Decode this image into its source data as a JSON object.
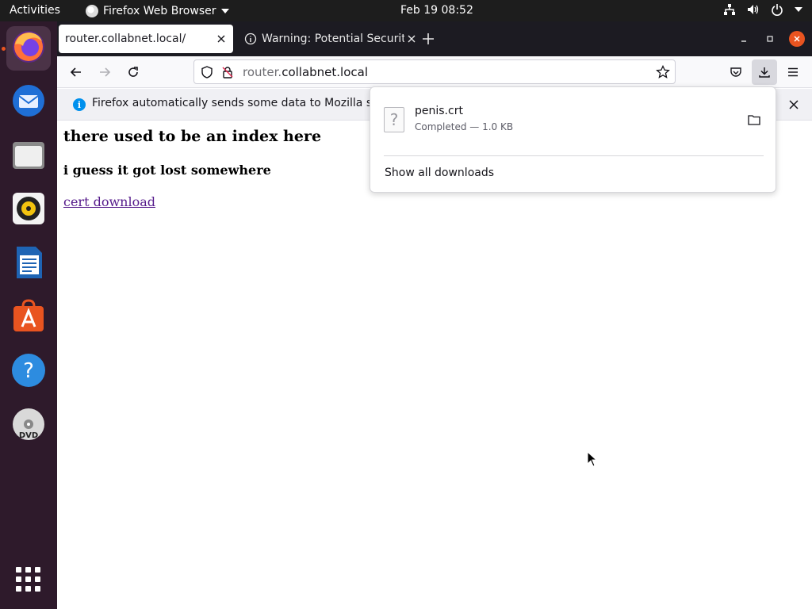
{
  "topbar": {
    "activities": "Activities",
    "app_name": "Firefox Web Browser",
    "clock": "Feb 19  08:52",
    "icons": [
      "network-icon",
      "volume-icon",
      "power-icon",
      "chevron-down-icon"
    ]
  },
  "dock": {
    "items": [
      "firefox",
      "thunderbird",
      "files",
      "rhythmbox",
      "libreoffice-writer",
      "ubuntu-software",
      "help",
      "dvd",
      "show-applications"
    ]
  },
  "browser": {
    "tabs": [
      {
        "title": "router.collabnet.local/",
        "active": true
      },
      {
        "title": "Warning: Potential Security Risk Ahead",
        "active": false
      }
    ],
    "url": {
      "dim": "router.",
      "host": "collabnet.local"
    },
    "notification": {
      "text": "Firefox automatically sends some data to Mozilla so that we can improve your experience."
    },
    "page": {
      "heading": "there used to be an index here",
      "subheading": "i guess it got lost somewhere",
      "link": "cert download"
    },
    "downloads_panel": {
      "file_name": "penis.crt",
      "status": "Completed — 1.0 KB",
      "show_all": "Show all downloads"
    }
  },
  "colors": {
    "accent": "#e95420",
    "dock_bg": "#2e1a2b",
    "topbar_bg": "#1d1d1d",
    "tabbar_bg": "#1c1b22",
    "link_visited": "#551a8b"
  }
}
